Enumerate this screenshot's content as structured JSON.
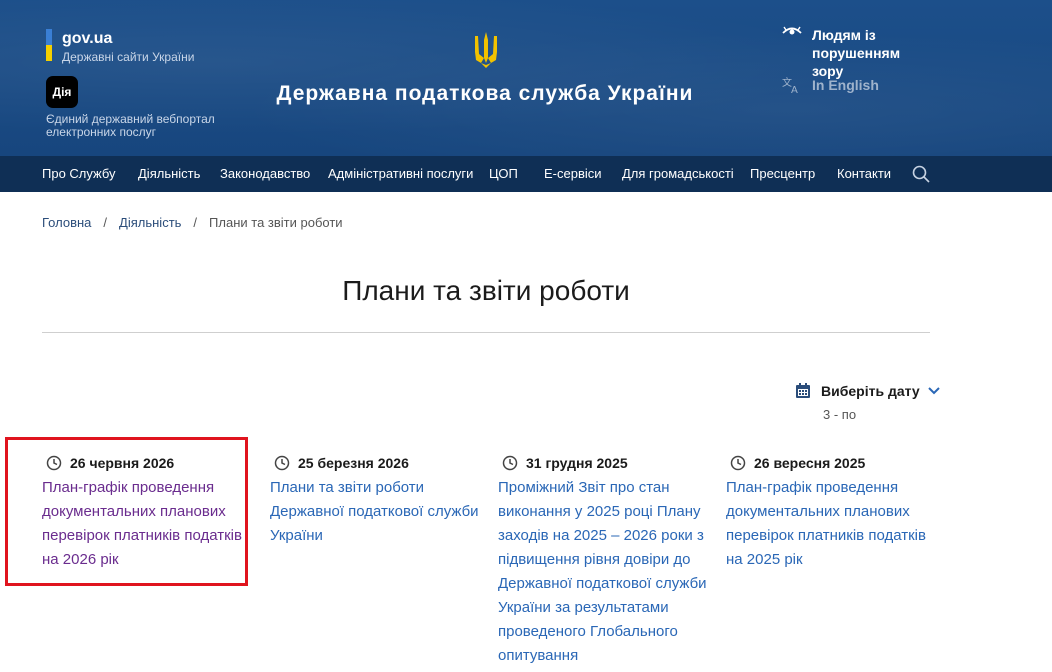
{
  "header": {
    "govua_title": "gov.ua",
    "govua_subtitle": "Державні сайти України",
    "diia_logo": "Дія",
    "diia_text": "Єдиний державний вебпортал електронних послуг",
    "site_title": "Державна податкова служба України",
    "accessibility_label": "Людям із порушенням зору",
    "language_label": "In English",
    "colors": {
      "header_bg": "#1c4f8a",
      "nav_bg": "#0f2f55",
      "flag_blue": "#3a7fd5",
      "flag_yellow": "#f5d000",
      "trident": "#f2c200"
    }
  },
  "nav": {
    "items": [
      "Про Службу",
      "Діяльність",
      "Законодавство",
      "Адміністративні послуги",
      "ЦОП",
      "Е-сервіси",
      "Для громадськості",
      "Пресцентр",
      "Контакти"
    ],
    "search_icon": "search-icon"
  },
  "breadcrumb": {
    "items": [
      "Головна",
      "Діяльність",
      "Плани та звіти роботи"
    ]
  },
  "page": {
    "title": "Плани та звіти роботи"
  },
  "filter": {
    "label": "Виберіть дату",
    "range": "3 - по"
  },
  "cards": [
    {
      "date": "26 червня 2026",
      "title": "План-графік проведення документальних планових перевірок платників податків на 2026 рік",
      "visited": true
    },
    {
      "date": "25 березня 2026",
      "title": "Плани та звіти роботи Державної податкової служби України",
      "visited": false
    },
    {
      "date": "31 грудня 2025",
      "title": "Проміжний Звіт про стан виконання у 2025 році Плану заходів на 2025 – 2026 роки з підвищення рівня довіри до Державної податкової служби України за результатами проведеного Глобального опитування",
      "visited": false
    },
    {
      "date": "26 вересня 2025",
      "title": "План-графік проведення документальних планових перевірок платників податків на 2025 рік",
      "visited": false
    }
  ],
  "colors": {
    "link": "#2a67b6",
    "visited_link": "#6a2c8e",
    "highlight_border": "#e0141e"
  }
}
